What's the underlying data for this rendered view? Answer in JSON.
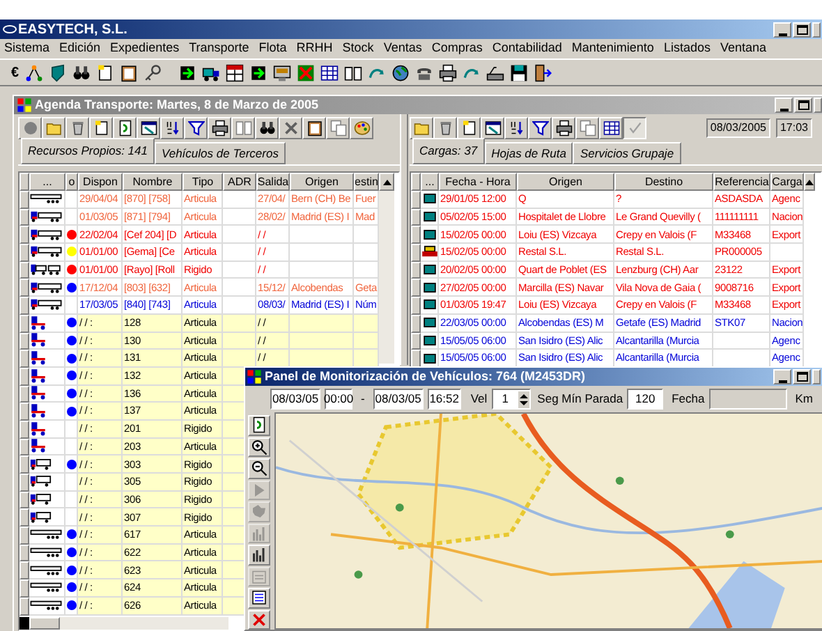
{
  "app": {
    "title": "EASYTECH, S.L."
  },
  "menu": [
    "Sistema",
    "Edición",
    "Expedientes",
    "Transporte",
    "Flota",
    "RRHH",
    "Stock",
    "Ventas",
    "Compras",
    "Contabilidad",
    "Mantenimiento",
    "Listados",
    "Ventana"
  ],
  "toolbar": {
    "currency": "€"
  },
  "agenda": {
    "title": "Agenda Transporte: Martes, 8 de Marzo de 2005",
    "left": {
      "tabs": [
        {
          "label": "Recursos Propios: 141",
          "selected": true
        },
        {
          "label": "Vehículos de Terceros",
          "selected": false
        }
      ],
      "columns": [
        "...",
        "o",
        "Dispon",
        "Nombre",
        "Tipo",
        "ADR",
        "Salida",
        "Origen",
        "estin"
      ],
      "rows": [
        {
          "kind": "trailer",
          "color": "#f0643c",
          "dispon": "29/04/04",
          "nombre": "[870] [758]",
          "tipo": "Articula",
          "salida": "27/04/",
          "origen": "Bern (CH) Be",
          "destino": "Fuer"
        },
        {
          "kind": "truck-trailer",
          "color": "#f0643c",
          "dispon": "01/03/05",
          "nombre": "[871] [794]",
          "tipo": "Articula",
          "salida": "28/02/",
          "origen": "Madrid (ES) I",
          "destino": "Mad"
        },
        {
          "kind": "truck-trailer",
          "color": "#f00000",
          "dot": {
            "color": "#ff0000"
          },
          "dispon": "22/02/04",
          "nombre": "[Cef 204] [D",
          "tipo": "Articula",
          "salida": "/ /"
        },
        {
          "kind": "truck-trailer",
          "color": "#f00000",
          "dot": {
            "color": "#ffff00"
          },
          "dispon": "01/01/00",
          "nombre": "[Gema] [Ce",
          "tipo": "Articula",
          "salida": "/ /"
        },
        {
          "kind": "drawbar",
          "color": "#f00000",
          "dot": {
            "color": "#ff0000"
          },
          "dispon": "01/01/00",
          "nombre": "[Rayo] [Roll",
          "tipo": "Rigido",
          "salida": "/ /"
        },
        {
          "kind": "truck-trailer",
          "color": "#f0643c",
          "dot": {
            "color": "#0000ff"
          },
          "dispon": "17/12/04",
          "nombre": "[803] [632]",
          "tipo": "Articula",
          "salida": "15/12/",
          "origen": "Alcobendas",
          "destino": "Geta"
        },
        {
          "kind": "truck-trailer",
          "color": "#0000d8",
          "dispon": "17/03/05",
          "nombre": "[840] [743]",
          "tipo": "Articula",
          "salida": "08/03/",
          "origen": "Madrid (ES) I",
          "destino": "Núm"
        },
        {
          "kind": "tractor",
          "dot": {
            "color": "#0000ff"
          },
          "dispon": "/ /   :",
          "nombre": "128",
          "tipo": "Articula",
          "salida": "/ /"
        },
        {
          "kind": "tractor",
          "dot": {
            "color": "#0000ff"
          },
          "dispon": "/ /   :",
          "nombre": "130",
          "tipo": "Articula",
          "salida": "/ /"
        },
        {
          "kind": "tractor",
          "dot": {
            "color": "#0000ff"
          },
          "dispon": "/ /   :",
          "nombre": "131",
          "tipo": "Articula",
          "salida": "/ /"
        },
        {
          "kind": "tractor",
          "dot": {
            "color": "#0000ff"
          },
          "dispon": "/ /   :",
          "nombre": "132",
          "tipo": "Articula"
        },
        {
          "kind": "tractor",
          "dot": {
            "color": "#0000ff"
          },
          "dispon": "/ /   :",
          "nombre": "136",
          "tipo": "Articula"
        },
        {
          "kind": "tractor",
          "dot": {
            "color": "#0000ff"
          },
          "dispon": "/ /   :",
          "nombre": "137",
          "tipo": "Articula"
        },
        {
          "kind": "tractor",
          "dispon": "/ /   :",
          "nombre": "201",
          "tipo": "Rigido"
        },
        {
          "kind": "tractor",
          "dispon": "/ /   :",
          "nombre": "203",
          "tipo": "Articula"
        },
        {
          "kind": "rigid",
          "dot": {
            "color": "#0000ff"
          },
          "dispon": "/ /   :",
          "nombre": "303",
          "tipo": "Rigido"
        },
        {
          "kind": "rigid",
          "dispon": "/ /   :",
          "nombre": "305",
          "tipo": "Rigido"
        },
        {
          "kind": "rigid",
          "dispon": "/ /   :",
          "nombre": "306",
          "tipo": "Rigido"
        },
        {
          "kind": "rigid",
          "dispon": "/ /   :",
          "nombre": "307",
          "tipo": "Rigido"
        },
        {
          "kind": "trailer",
          "dot": {
            "color": "#0000ff"
          },
          "dispon": "/ /   :",
          "nombre": "617",
          "tipo": "Articula"
        },
        {
          "kind": "trailer",
          "dot": {
            "color": "#0000ff"
          },
          "dispon": "/ /   :",
          "nombre": "622",
          "tipo": "Articula"
        },
        {
          "kind": "trailer",
          "dot": {
            "color": "#0000ff"
          },
          "dispon": "/ /   :",
          "nombre": "623",
          "tipo": "Articula"
        },
        {
          "kind": "trailer",
          "dot": {
            "color": "#0000ff"
          },
          "dispon": "/ /   :",
          "nombre": "624",
          "tipo": "Articula"
        },
        {
          "kind": "trailer",
          "dot": {
            "color": "#0000ff"
          },
          "dispon": "/ /   :",
          "nombre": "626",
          "tipo": "Articula"
        }
      ]
    },
    "right": {
      "date": "08/03/2005",
      "time": "17:03",
      "tabs": [
        {
          "label": "Cargas: 37",
          "selected": true
        },
        {
          "label": "Hojas de Ruta",
          "selected": false
        },
        {
          "label": "Servicios Grupaje",
          "selected": false
        }
      ],
      "columns": [
        "...",
        "Fecha - Hora",
        "Origen",
        "Destino",
        "Referencia",
        "Carga"
      ],
      "rows": [
        {
          "kind": "screen",
          "color": "#f00000",
          "fecha": "29/01/05 12:00",
          "origen": "Q",
          "destino": "?",
          "referencia": "ASDASDA",
          "carga": "Agenc"
        },
        {
          "kind": "screen",
          "color": "#f00000",
          "fecha": "05/02/05 15:00",
          "origen": "Hospitalet de Llobre",
          "destino": "Le Grand Quevilly (",
          "referencia": "111111111",
          "carga": "Nacion"
        },
        {
          "kind": "screen",
          "color": "#f00000",
          "fecha": "15/02/05 00:00",
          "origen": "Loiu (ES) Vizcaya",
          "destino": "Crepy en Valois (F",
          "referencia": "M33468",
          "carga": "Export"
        },
        {
          "kind": "crate",
          "color": "#f00000",
          "fecha": "15/02/05 00:00",
          "origen": "Restal S.L.",
          "destino": "Restal S.L.",
          "referencia": "PR000005"
        },
        {
          "kind": "screen",
          "color": "#f00000",
          "fecha": "20/02/05 00:00",
          "origen": "Quart de Poblet (ES",
          "destino": "Lenzburg (CH) Aar",
          "referencia": "23122",
          "carga": "Export"
        },
        {
          "kind": "screen",
          "color": "#f00000",
          "fecha": "27/02/05 00:00",
          "origen": "Marcilla (ES) Navar",
          "destino": "Vila Nova de Gaia (",
          "referencia": "9008716",
          "carga": "Export"
        },
        {
          "kind": "screen",
          "color": "#f00000",
          "fecha": "01/03/05 19:47",
          "origen": "Loiu (ES) Vizcaya",
          "destino": "Crepy en Valois (F",
          "referencia": "M33468",
          "carga": "Export"
        },
        {
          "kind": "screen",
          "color": "#0000d8",
          "fecha": "22/03/05 00:00",
          "origen": "Alcobendas (ES) M",
          "destino": "Getafe (ES) Madrid",
          "referencia": "STK07",
          "carga": "Nacion"
        },
        {
          "kind": "screen",
          "color": "#0000d8",
          "fecha": "15/05/05 06:00",
          "origen": "San Isidro (ES) Alic",
          "destino": "Alcantarilla (Murcia",
          "carga": "Agenc"
        },
        {
          "kind": "screen",
          "color": "#0000d8",
          "fecha": "15/05/05 06:00",
          "origen": "San Isidro (ES) Alic",
          "destino": "Alcantarilla (Murcia",
          "carga": "Agenc"
        }
      ]
    }
  },
  "monitor": {
    "title": "Panel de Monitorización de Vehículos: 764 (M2453DR)",
    "from_date": "08/03/05",
    "from_time": "00:00",
    "separator": "-",
    "to_date": "08/03/05",
    "to_time": "16:52",
    "vel_label": "Vel",
    "vel": "1",
    "stop_label": "Seg Mín Parada",
    "stop": "120",
    "fecha_label": "Fecha",
    "unit_label": "Km",
    "tools": [
      {
        "kind": "refresh",
        "disabled": false
      },
      {
        "kind": "zoomin",
        "disabled": false
      },
      {
        "kind": "zoomout",
        "disabled": false
      },
      {
        "kind": "play",
        "disabled": true
      },
      {
        "kind": "map",
        "disabled": true
      },
      {
        "kind": "chart",
        "disabled": true
      },
      {
        "kind": "bars",
        "disabled": false
      },
      {
        "kind": "properties",
        "disabled": true
      },
      {
        "kind": "export",
        "disabled": false
      },
      {
        "kind": "closex",
        "disabled": false
      }
    ]
  }
}
